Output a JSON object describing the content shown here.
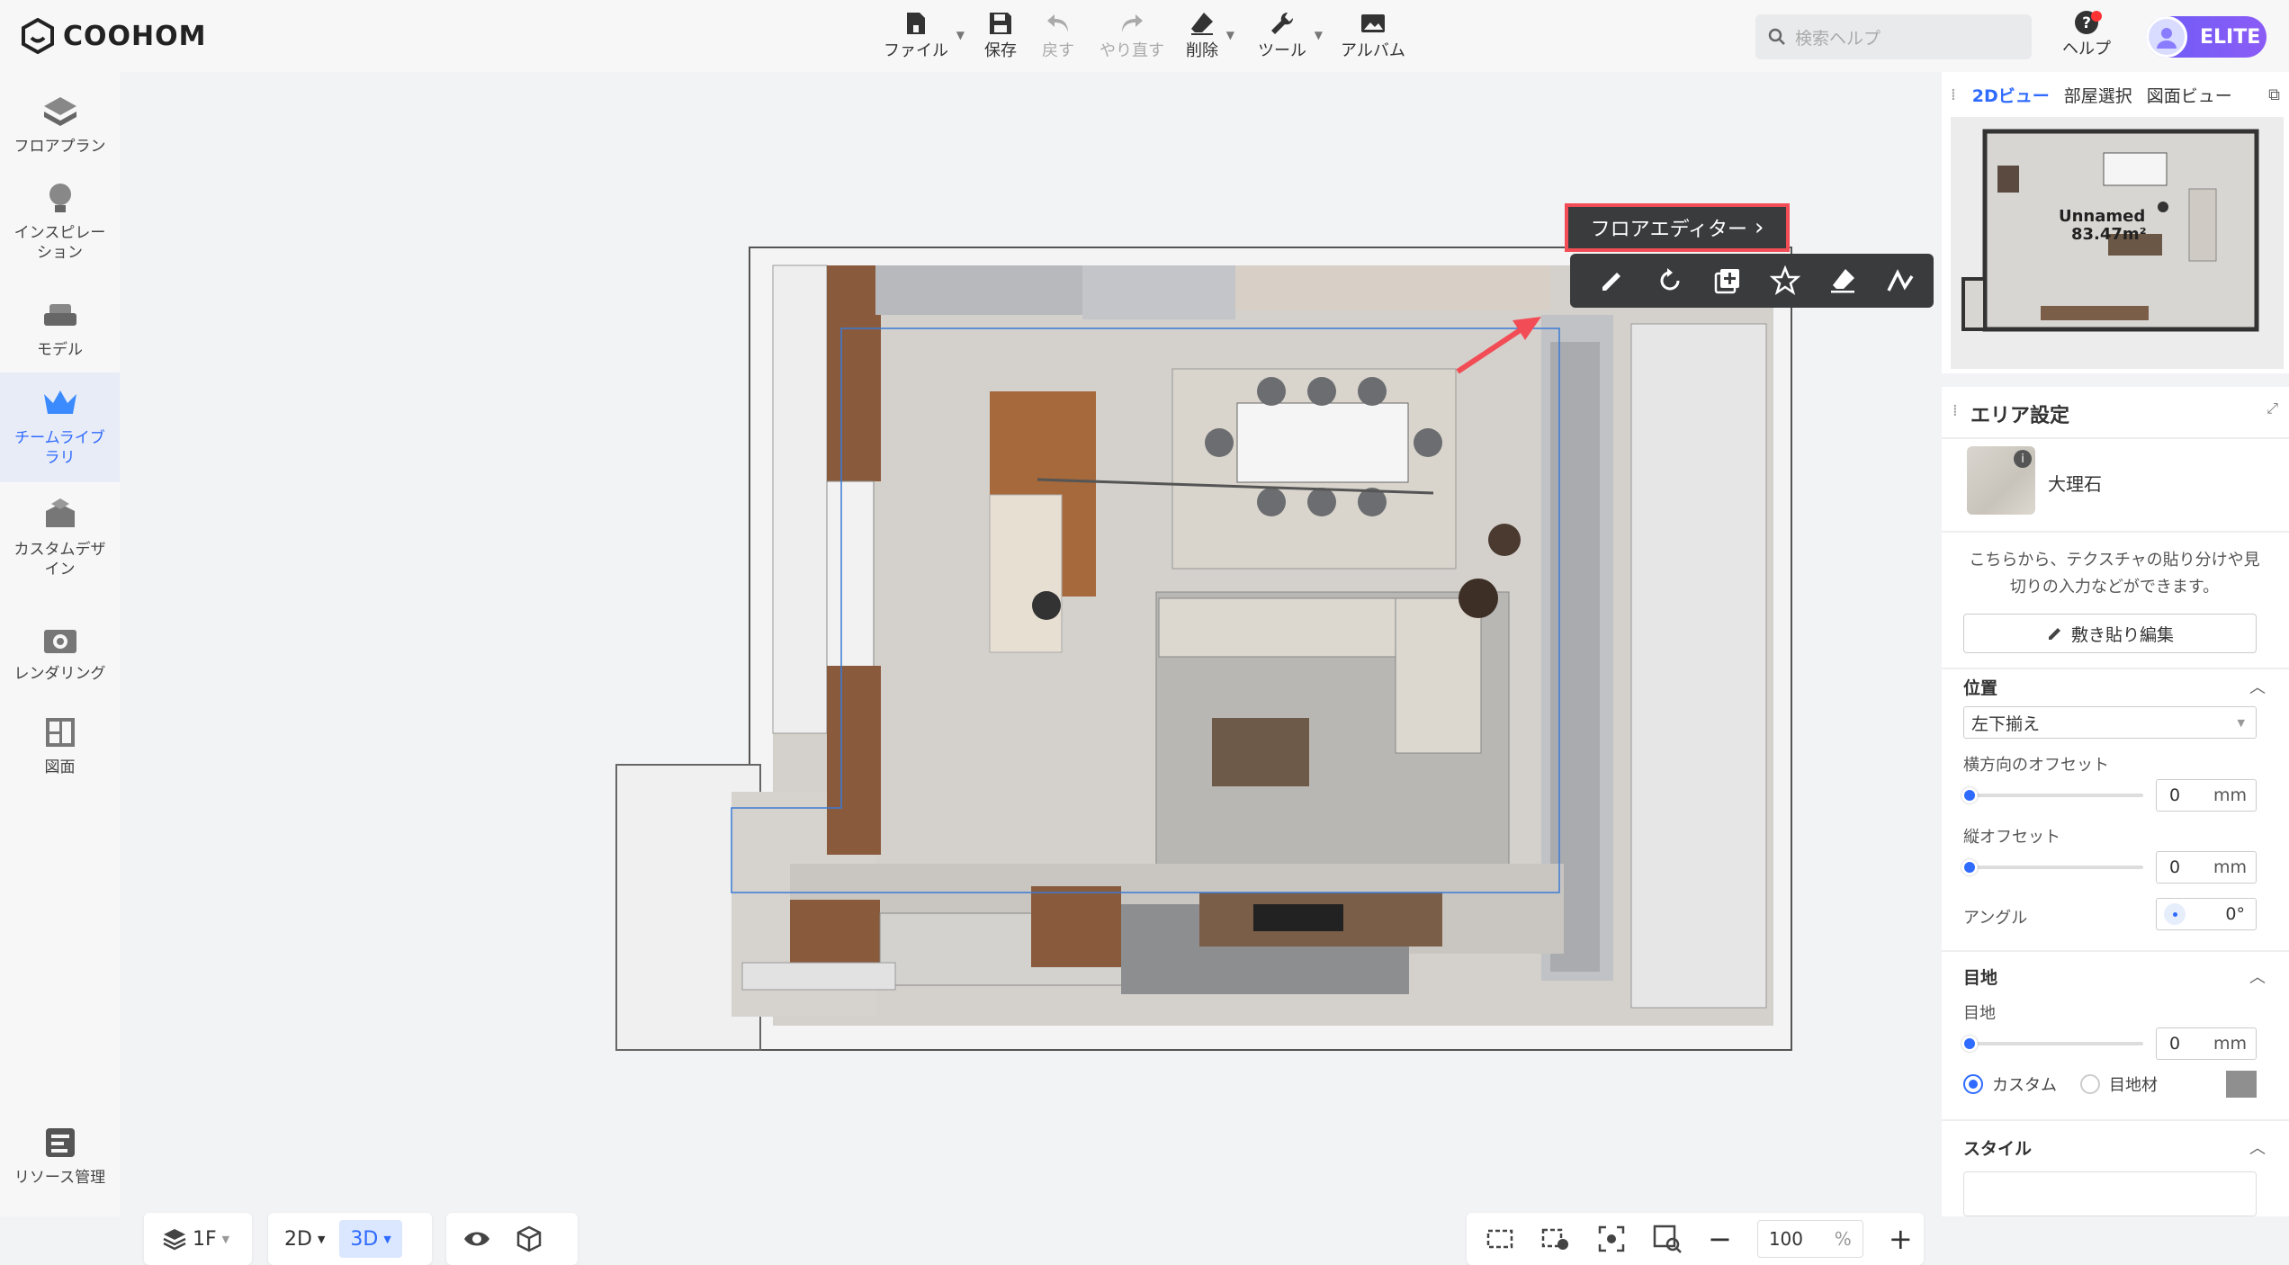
{
  "app": {
    "brand": "COOHOM"
  },
  "toolbar": {
    "file": "ファイル",
    "save": "保存",
    "undo": "戻す",
    "redo": "やり直す",
    "delete": "削除",
    "tools": "ツール",
    "album": "アルバム"
  },
  "search": {
    "placeholder": "検索ヘルプ"
  },
  "help": {
    "label": "ヘルプ"
  },
  "user": {
    "badge": "ELITE"
  },
  "sidebar": {
    "items": [
      {
        "label": "フロアプラン"
      },
      {
        "label": "インスピレーション"
      },
      {
        "label": "モデル"
      },
      {
        "label": "チームライブラリ"
      },
      {
        "label": "カスタムデザイン"
      },
      {
        "label": "レンダリング"
      },
      {
        "label": "図面"
      }
    ],
    "resource": "リソース管理"
  },
  "canvas": {
    "floor_editor": "フロアエディター",
    "minimap_room": "Unnamed",
    "minimap_area": "83.47m²"
  },
  "view_tabs": [
    "2Dビュー",
    "部屋選択",
    "図面ビュー"
  ],
  "area_settings": {
    "title": "エリア設定",
    "material": "大理石",
    "description": "こちらから、テクスチャの貼り分けや見切りの入力などができます。",
    "edit_button": "敷き貼り編集",
    "position": {
      "heading": "位置",
      "align": "左下揃え",
      "h_offset_label": "横方向のオフセット",
      "h_offset": "0",
      "v_offset_label": "縦オフセット",
      "v_offset": "0",
      "angle_label": "アングル",
      "angle": "0°",
      "unit": "mm"
    },
    "joint": {
      "heading": "目地",
      "joint_label": "目地",
      "joint_value": "0",
      "custom": "カスタム",
      "joint_material": "目地材"
    },
    "style": {
      "heading": "スタイル"
    }
  },
  "bottom": {
    "floor": "1F",
    "view2d": "2D",
    "view3d": "3D",
    "zoom": "100",
    "zoom_unit": "%"
  }
}
